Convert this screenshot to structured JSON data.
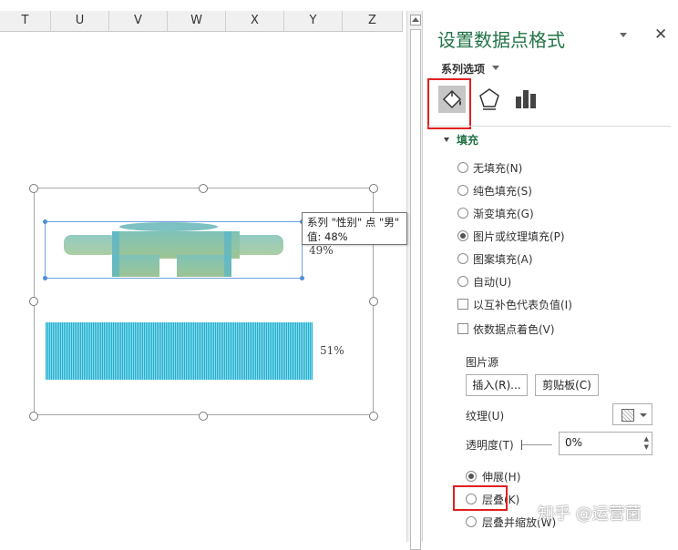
{
  "columns": [
    "T",
    "U",
    "V",
    "W",
    "X",
    "Y",
    "Z"
  ],
  "chart": {
    "male_label": "49%",
    "female_label": "51%",
    "tooltip_line1": "系列 \"性别\" 点 \"男\"",
    "tooltip_line2": "值: 48%"
  },
  "pane": {
    "title": "设置数据点格式",
    "close": "✕",
    "series_options": "系列选项",
    "tabs": [
      "fill-line",
      "effects",
      "series-options"
    ],
    "fill_section": "填充",
    "fill_options": [
      {
        "label": "无填充(N)",
        "selected": false
      },
      {
        "label": "纯色填充(S)",
        "selected": false
      },
      {
        "label": "渐变填充(G)",
        "selected": false
      },
      {
        "label": "图片或纹理填充(P)",
        "selected": true
      },
      {
        "label": "图案填充(A)",
        "selected": false
      },
      {
        "label": "自动(U)",
        "selected": false
      }
    ],
    "checkbox_invert": "以互补色代表负值(I)",
    "checkbox_vary": "依数据点着色(V)",
    "picture_source": "图片源",
    "insert_button": "插入(R)...",
    "clipboard_button": "剪贴板(C)",
    "texture_label": "纹理(U)",
    "transparency_label": "透明度(T)",
    "transparency_value": "0%",
    "stretch": "伸展(H)",
    "stack": "层叠(K)",
    "stack_scale": "层叠并缩放(W)",
    "watermark": "知乎 @运营菌"
  },
  "colors": {
    "accent": "#217346",
    "highlight": "#e02020",
    "bar_cyan": "#21b0cf"
  }
}
